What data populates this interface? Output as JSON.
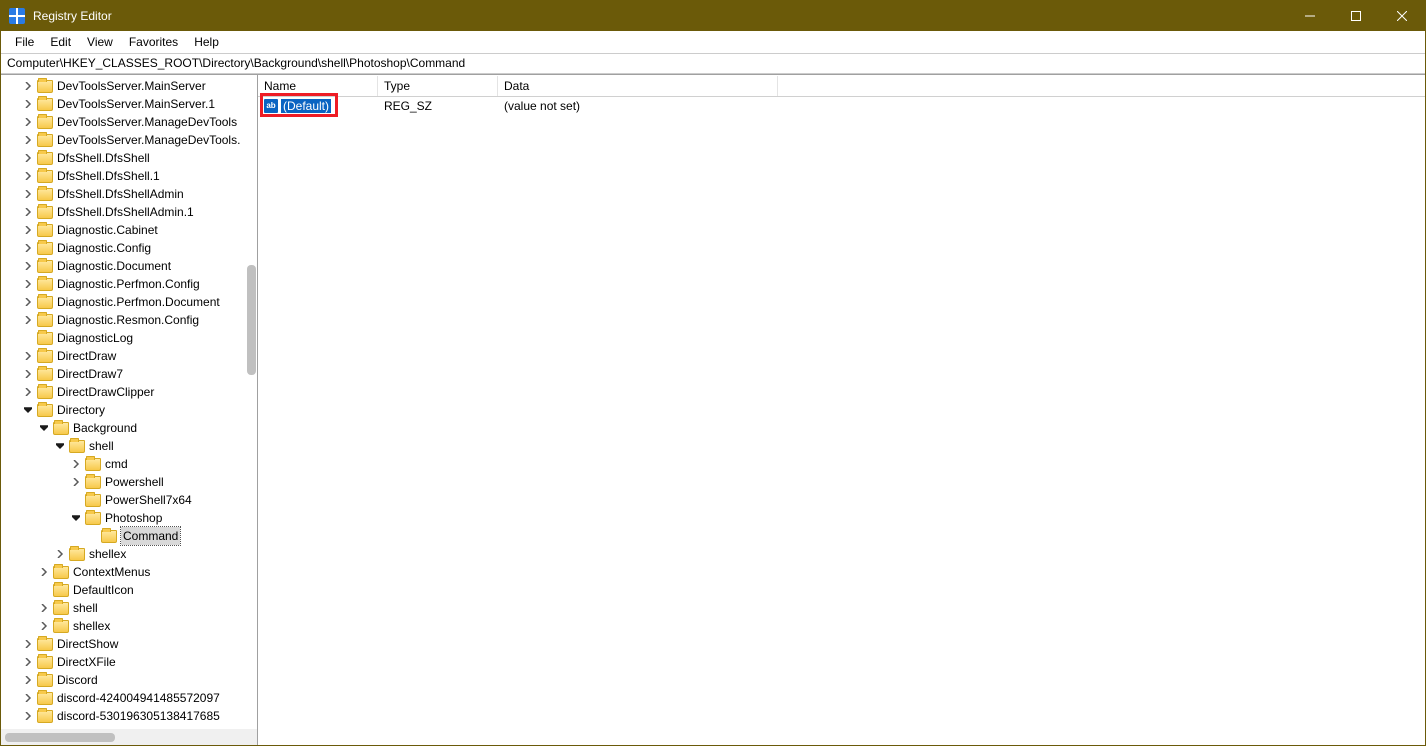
{
  "window": {
    "title": "Registry Editor"
  },
  "menu": {
    "file": "File",
    "edit": "Edit",
    "view": "View",
    "favorites": "Favorites",
    "help": "Help"
  },
  "address": "Computer\\HKEY_CLASSES_ROOT\\Directory\\Background\\shell\\Photoshop\\Command",
  "columns": {
    "name": "Name",
    "type": "Type",
    "data": "Data"
  },
  "values": [
    {
      "icon": "ab",
      "name": "(Default)",
      "type": "REG_SZ",
      "data": "(value not set)",
      "selected": true
    }
  ],
  "tree": [
    {
      "depth": 1,
      "exp": "closed",
      "label": "DevToolsServer.MainServer"
    },
    {
      "depth": 1,
      "exp": "closed",
      "label": "DevToolsServer.MainServer.1"
    },
    {
      "depth": 1,
      "exp": "closed",
      "label": "DevToolsServer.ManageDevTools"
    },
    {
      "depth": 1,
      "exp": "closed",
      "label": "DevToolsServer.ManageDevTools."
    },
    {
      "depth": 1,
      "exp": "closed",
      "label": "DfsShell.DfsShell"
    },
    {
      "depth": 1,
      "exp": "closed",
      "label": "DfsShell.DfsShell.1"
    },
    {
      "depth": 1,
      "exp": "closed",
      "label": "DfsShell.DfsShellAdmin"
    },
    {
      "depth": 1,
      "exp": "closed",
      "label": "DfsShell.DfsShellAdmin.1"
    },
    {
      "depth": 1,
      "exp": "closed",
      "label": "Diagnostic.Cabinet"
    },
    {
      "depth": 1,
      "exp": "closed",
      "label": "Diagnostic.Config"
    },
    {
      "depth": 1,
      "exp": "closed",
      "label": "Diagnostic.Document"
    },
    {
      "depth": 1,
      "exp": "closed",
      "label": "Diagnostic.Perfmon.Config"
    },
    {
      "depth": 1,
      "exp": "closed",
      "label": "Diagnostic.Perfmon.Document"
    },
    {
      "depth": 1,
      "exp": "closed",
      "label": "Diagnostic.Resmon.Config"
    },
    {
      "depth": 1,
      "exp": "none",
      "label": "DiagnosticLog"
    },
    {
      "depth": 1,
      "exp": "closed",
      "label": "DirectDraw"
    },
    {
      "depth": 1,
      "exp": "closed",
      "label": "DirectDraw7"
    },
    {
      "depth": 1,
      "exp": "closed",
      "label": "DirectDrawClipper"
    },
    {
      "depth": 1,
      "exp": "open",
      "label": "Directory"
    },
    {
      "depth": 2,
      "exp": "open",
      "label": "Background"
    },
    {
      "depth": 3,
      "exp": "open",
      "label": "shell"
    },
    {
      "depth": 4,
      "exp": "closed",
      "label": "cmd"
    },
    {
      "depth": 4,
      "exp": "closed",
      "label": "Powershell"
    },
    {
      "depth": 4,
      "exp": "none",
      "label": "PowerShell7x64"
    },
    {
      "depth": 4,
      "exp": "open",
      "label": "Photoshop"
    },
    {
      "depth": 5,
      "exp": "none",
      "label": "Command",
      "selected": true
    },
    {
      "depth": 3,
      "exp": "closed",
      "label": "shellex"
    },
    {
      "depth": 2,
      "exp": "closed",
      "label": "ContextMenus"
    },
    {
      "depth": 2,
      "exp": "none",
      "label": "DefaultIcon"
    },
    {
      "depth": 2,
      "exp": "closed",
      "label": "shell"
    },
    {
      "depth": 2,
      "exp": "closed",
      "label": "shellex"
    },
    {
      "depth": 1,
      "exp": "closed",
      "label": "DirectShow"
    },
    {
      "depth": 1,
      "exp": "closed",
      "label": "DirectXFile"
    },
    {
      "depth": 1,
      "exp": "closed",
      "label": "Discord"
    },
    {
      "depth": 1,
      "exp": "closed",
      "label": "discord-424004941485572097"
    },
    {
      "depth": 1,
      "exp": "closed",
      "label": "discord-530196305138417685"
    }
  ]
}
